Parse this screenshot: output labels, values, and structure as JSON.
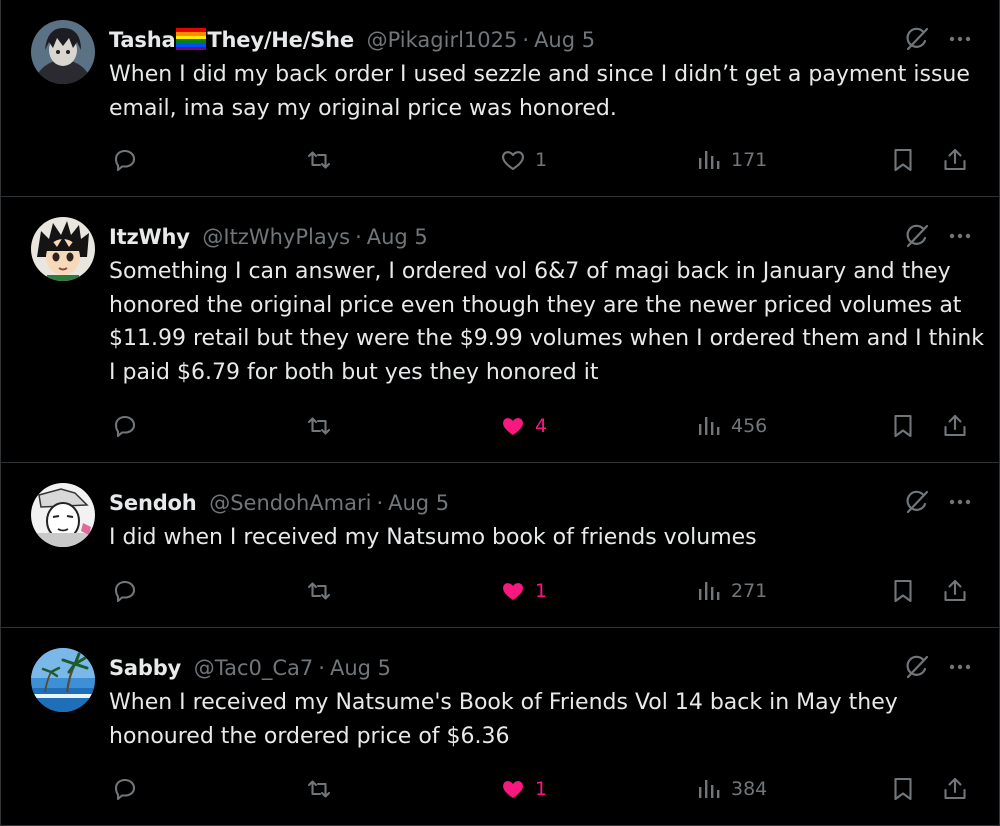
{
  "tweets": [
    {
      "name": "Tasha",
      "name_suffix": "They/He/She",
      "handle": "@Pikagirl1025",
      "separator": "·",
      "date": "Aug 5",
      "text_lines": [
        "When I did my back order I used sezzle and since I didn’t get a payment issue",
        "email, ima say my original price was honored."
      ],
      "likes": "1",
      "liked": false,
      "views": "171"
    },
    {
      "name": "ItzWhy",
      "handle": "@ItzWhyPlays",
      "separator": "·",
      "date": "Aug 5",
      "text_lines": [
        "Something I can answer, I ordered vol 6&7 of magi back in January and they",
        "honored the original price even though they are the newer priced volumes at",
        "$11.99 retail but they were the $9.99 volumes when I ordered them and I think",
        "I paid $6.79 for both but yes they honored it"
      ],
      "likes": "4",
      "liked": true,
      "views": "456"
    },
    {
      "name": "Sendoh",
      "handle": "@SendohAmari",
      "separator": "·",
      "date": "Aug 5",
      "text_lines": [
        "I did when I received my Natsumo book of friends volumes"
      ],
      "likes": "1",
      "liked": true,
      "views": "271"
    },
    {
      "name": "Sabby",
      "handle": "@Tac0_Ca7",
      "separator": "·",
      "date": "Aug 5",
      "text_lines": [
        "When I received my Natsume's Book of Friends Vol 14 back in May they",
        "honoured the ordered price of $6.36"
      ],
      "likes": "1",
      "liked": true,
      "views": "384"
    }
  ],
  "icons": {
    "reply": "reply-icon",
    "retweet": "retweet-icon",
    "like": "heart-icon",
    "views": "views-icon",
    "bookmark": "bookmark-icon",
    "share": "share-icon",
    "grok": "grok-icon",
    "more": "more-icon"
  },
  "colors": {
    "background": "#000000",
    "text": "#e7e9ea",
    "secondary": "#71767b",
    "divider": "#2f3336",
    "like": "#f91880"
  }
}
